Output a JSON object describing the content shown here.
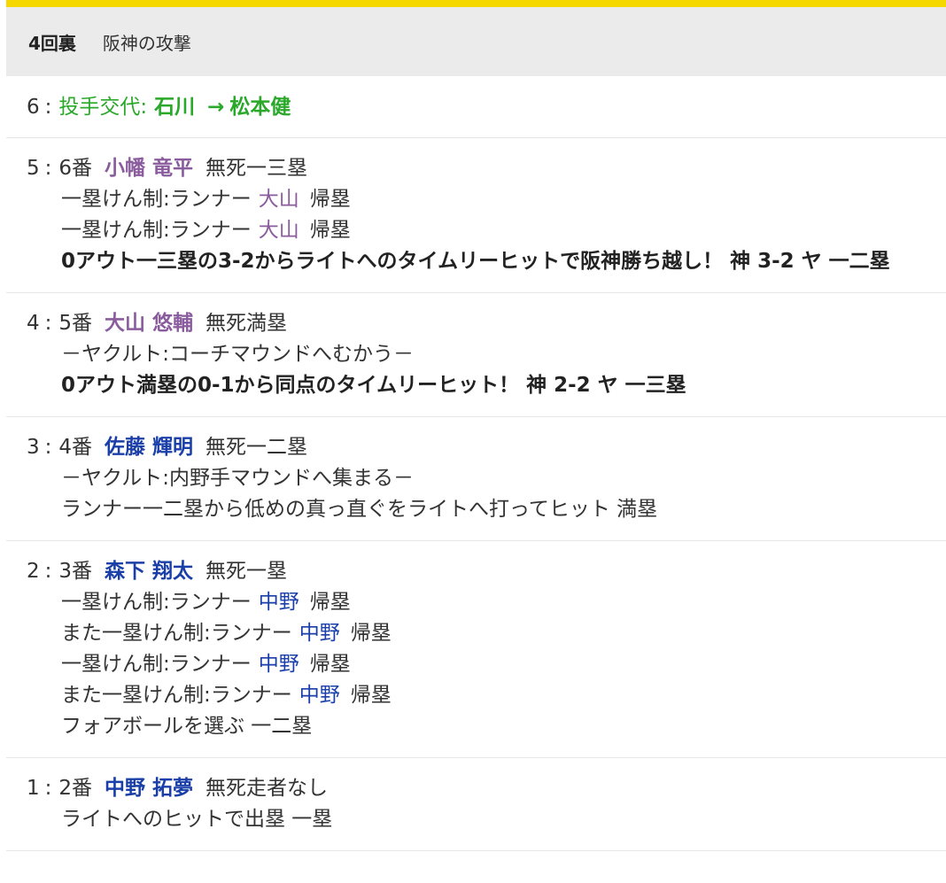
{
  "header": {
    "inning": "4回裏",
    "description": "阪神の攻撃"
  },
  "colors": {
    "accent_bar": "#f5d800",
    "header_bg": "#ebebeb",
    "hanshin_player": "#8a5c9e",
    "yakult_player": "#1a3fa8",
    "pitcher_change": "#2aa82a"
  },
  "plays": [
    {
      "number": "6",
      "sep": ":",
      "label": "投手交代:",
      "from": "石川",
      "arrow": "→",
      "to": "松本健"
    },
    {
      "number": "5",
      "sep": ":",
      "order": "6番",
      "batter": "小幡 竜平",
      "situation": "無死一三塁",
      "events": [
        {
          "prefix": "一塁けん制:ランナー",
          "runner": "大山",
          "suffix": "帰塁"
        },
        {
          "prefix": "一塁けん制:ランナー",
          "runner": "大山",
          "suffix": "帰塁"
        }
      ],
      "result": "0アウト一三塁の3-2からライトへのタイムリーヒットで阪神勝ち越し！ 神 3-2 ヤ 一二塁"
    },
    {
      "number": "4",
      "sep": ":",
      "order": "5番",
      "batter": "大山 悠輔",
      "situation": "無死満塁",
      "note": "－ヤクルト:コーチマウンドへむかう－",
      "result": "0アウト満塁の0-1から同点のタイムリーヒット！ 神 2-2 ヤ 一三塁"
    },
    {
      "number": "3",
      "sep": ":",
      "order": "4番",
      "batter": "佐藤 輝明",
      "situation": "無死一二塁",
      "note": "－ヤクルト:内野手マウンドへ集まる－",
      "result": "ランナー一二塁から低めの真っ直ぐをライトへ打ってヒット 満塁"
    },
    {
      "number": "2",
      "sep": ":",
      "order": "3番",
      "batter": "森下 翔太",
      "situation": "無死一塁",
      "events": [
        {
          "prefix": "一塁けん制:ランナー",
          "runner": "中野",
          "suffix": "帰塁"
        },
        {
          "prefix": "また一塁けん制:ランナー",
          "runner": "中野",
          "suffix": "帰塁"
        },
        {
          "prefix": "一塁けん制:ランナー",
          "runner": "中野",
          "suffix": "帰塁"
        },
        {
          "prefix": "また一塁けん制:ランナー",
          "runner": "中野",
          "suffix": "帰塁"
        }
      ],
      "result": "フォアボールを選ぶ 一二塁"
    },
    {
      "number": "1",
      "sep": ":",
      "order": "2番",
      "batter": "中野 拓夢",
      "situation": "無死走者なし",
      "result": "ライトへのヒットで出塁 一塁"
    }
  ]
}
